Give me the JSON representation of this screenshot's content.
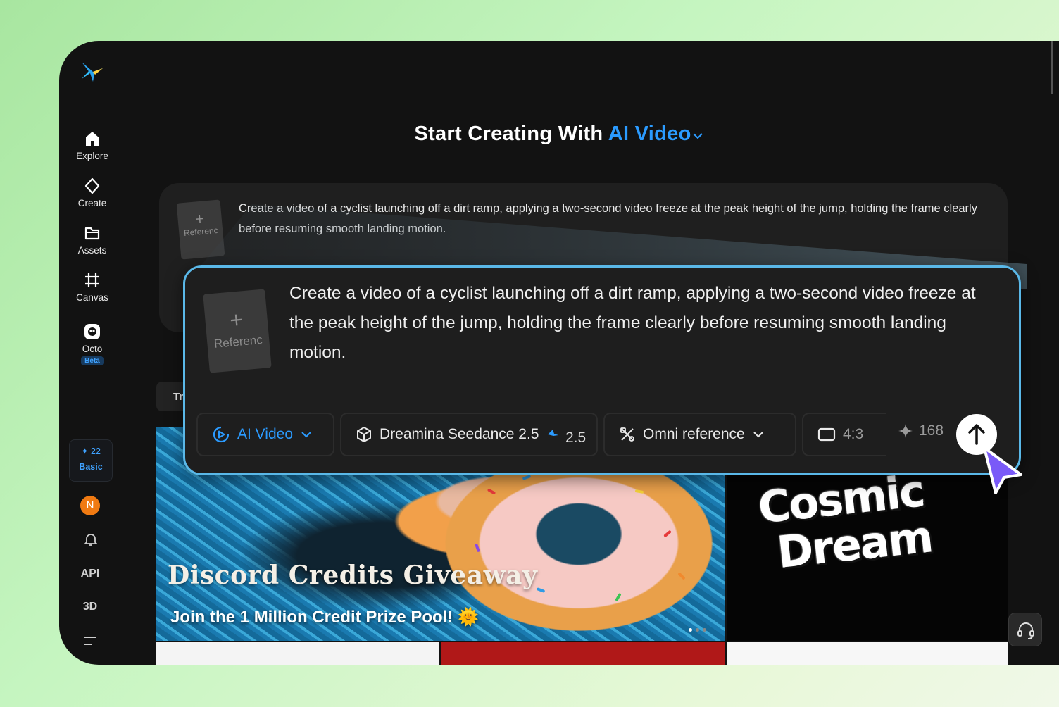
{
  "sidebar": {
    "items": [
      {
        "label": "Explore",
        "icon": "home-icon"
      },
      {
        "label": "Create",
        "icon": "diamond-icon"
      },
      {
        "label": "Assets",
        "icon": "folder-icon"
      },
      {
        "label": "Canvas",
        "icon": "crop-icon"
      },
      {
        "label": "Octo",
        "icon": "octo-icon",
        "badge": "Beta"
      }
    ],
    "credits": {
      "amount": "22",
      "tier": "Basic"
    },
    "avatar_initial": "N",
    "api_label": "API",
    "three_d_label": "3D"
  },
  "header": {
    "title_prefix": "Start Creating With",
    "title_accent": "AI Video"
  },
  "background_prompt": {
    "reference_label": "Referenc",
    "text": "Create a video of a cyclist launching off a dirt ramp, applying a two-second video freeze at the peak height of the jump, holding the frame clearly before resuming smooth landing motion."
  },
  "tab_stub": "Tr",
  "banners": {
    "left": {
      "title": "Discord Credits Giveaway",
      "subtitle": "Join the 1 Million Credit Prize Pool! 🌞"
    },
    "right": {
      "line1": "Cosmic",
      "line2": "Dream"
    }
  },
  "zoom_panel": {
    "reference_label": "Referenc",
    "prompt": "Create a video of a cyclist launching off a dirt ramp, applying a two-second video freeze at the peak height of the jump, holding the frame clearly before resuming smooth landing motion.",
    "mode_label": "AI Video",
    "model_label": "Dreamina Seedance 2.5",
    "model_version": "2.5",
    "reference_mode": "Omni reference",
    "aspect_ratio": "4:3",
    "cost": "168"
  },
  "colors": {
    "accent": "#2b9bff",
    "frame_bg": "#121212",
    "zoom_border": "#5ab8e8"
  }
}
